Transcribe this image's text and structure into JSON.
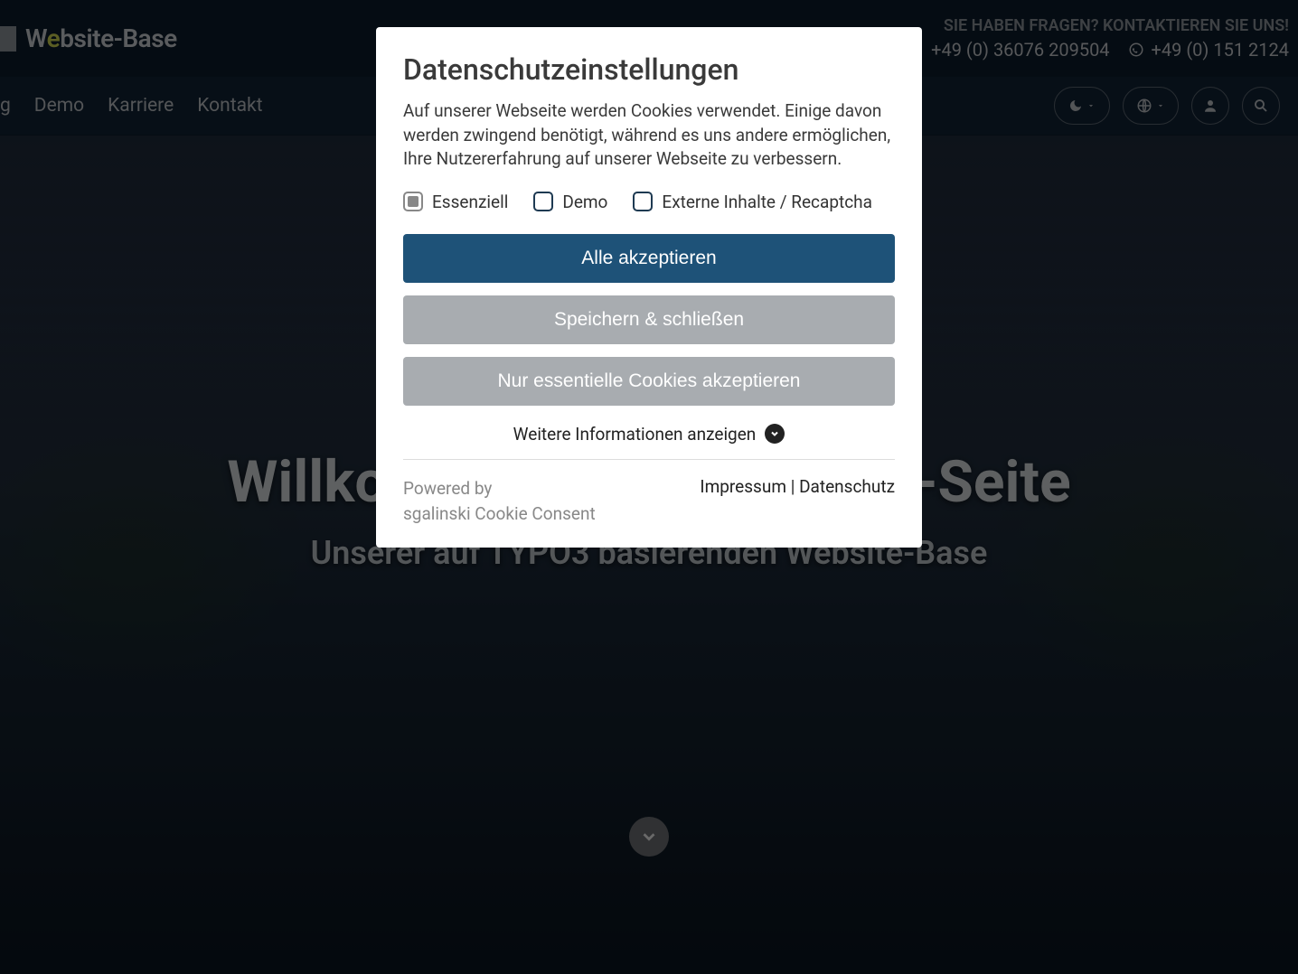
{
  "header": {
    "logo_text_pre": "W",
    "logo_text_accent": "e",
    "logo_text_post": "bsite-Base",
    "contact_heading": "SIE HABEN FRAGEN? KONTAKTIEREN SIE UNS!",
    "phone1": "+49 (0) 36076 209504",
    "phone2": "+49 (0) 151 2124"
  },
  "nav": {
    "items": [
      "g",
      "Demo",
      "Karriere",
      "Kontakt"
    ]
  },
  "hero": {
    "title": "Willkommen auf der Demo-Seite",
    "subtitle": "Unserer auf TYPO3 basierenden Website-Base"
  },
  "modal": {
    "title": "Datenschutzeinstellungen",
    "description": "Auf unserer Webseite werden Cookies verwendet. Einige davon werden zwingend benötigt, während es uns andere ermöglichen, Ihre Nutzererfahrung auf unserer Webseite zu verbessern.",
    "checkboxes": [
      {
        "label": "Essenziell",
        "checked": true,
        "disabled": true
      },
      {
        "label": "Demo",
        "checked": false,
        "disabled": false
      },
      {
        "label": "Externe Inhalte / Recaptcha",
        "checked": false,
        "disabled": false
      }
    ],
    "btn_accept_all": "Alle akzeptieren",
    "btn_save_close": "Speichern & schließen",
    "btn_essential_only": "Nur essentielle Cookies akzeptieren",
    "more_info": "Weitere Informationen anzeigen",
    "powered_by_label": "Powered by",
    "powered_by_name": "sgalinski Cookie Consent",
    "link_impressum": "Impressum",
    "link_separator": " | ",
    "link_datenschutz": "Datenschutz"
  }
}
